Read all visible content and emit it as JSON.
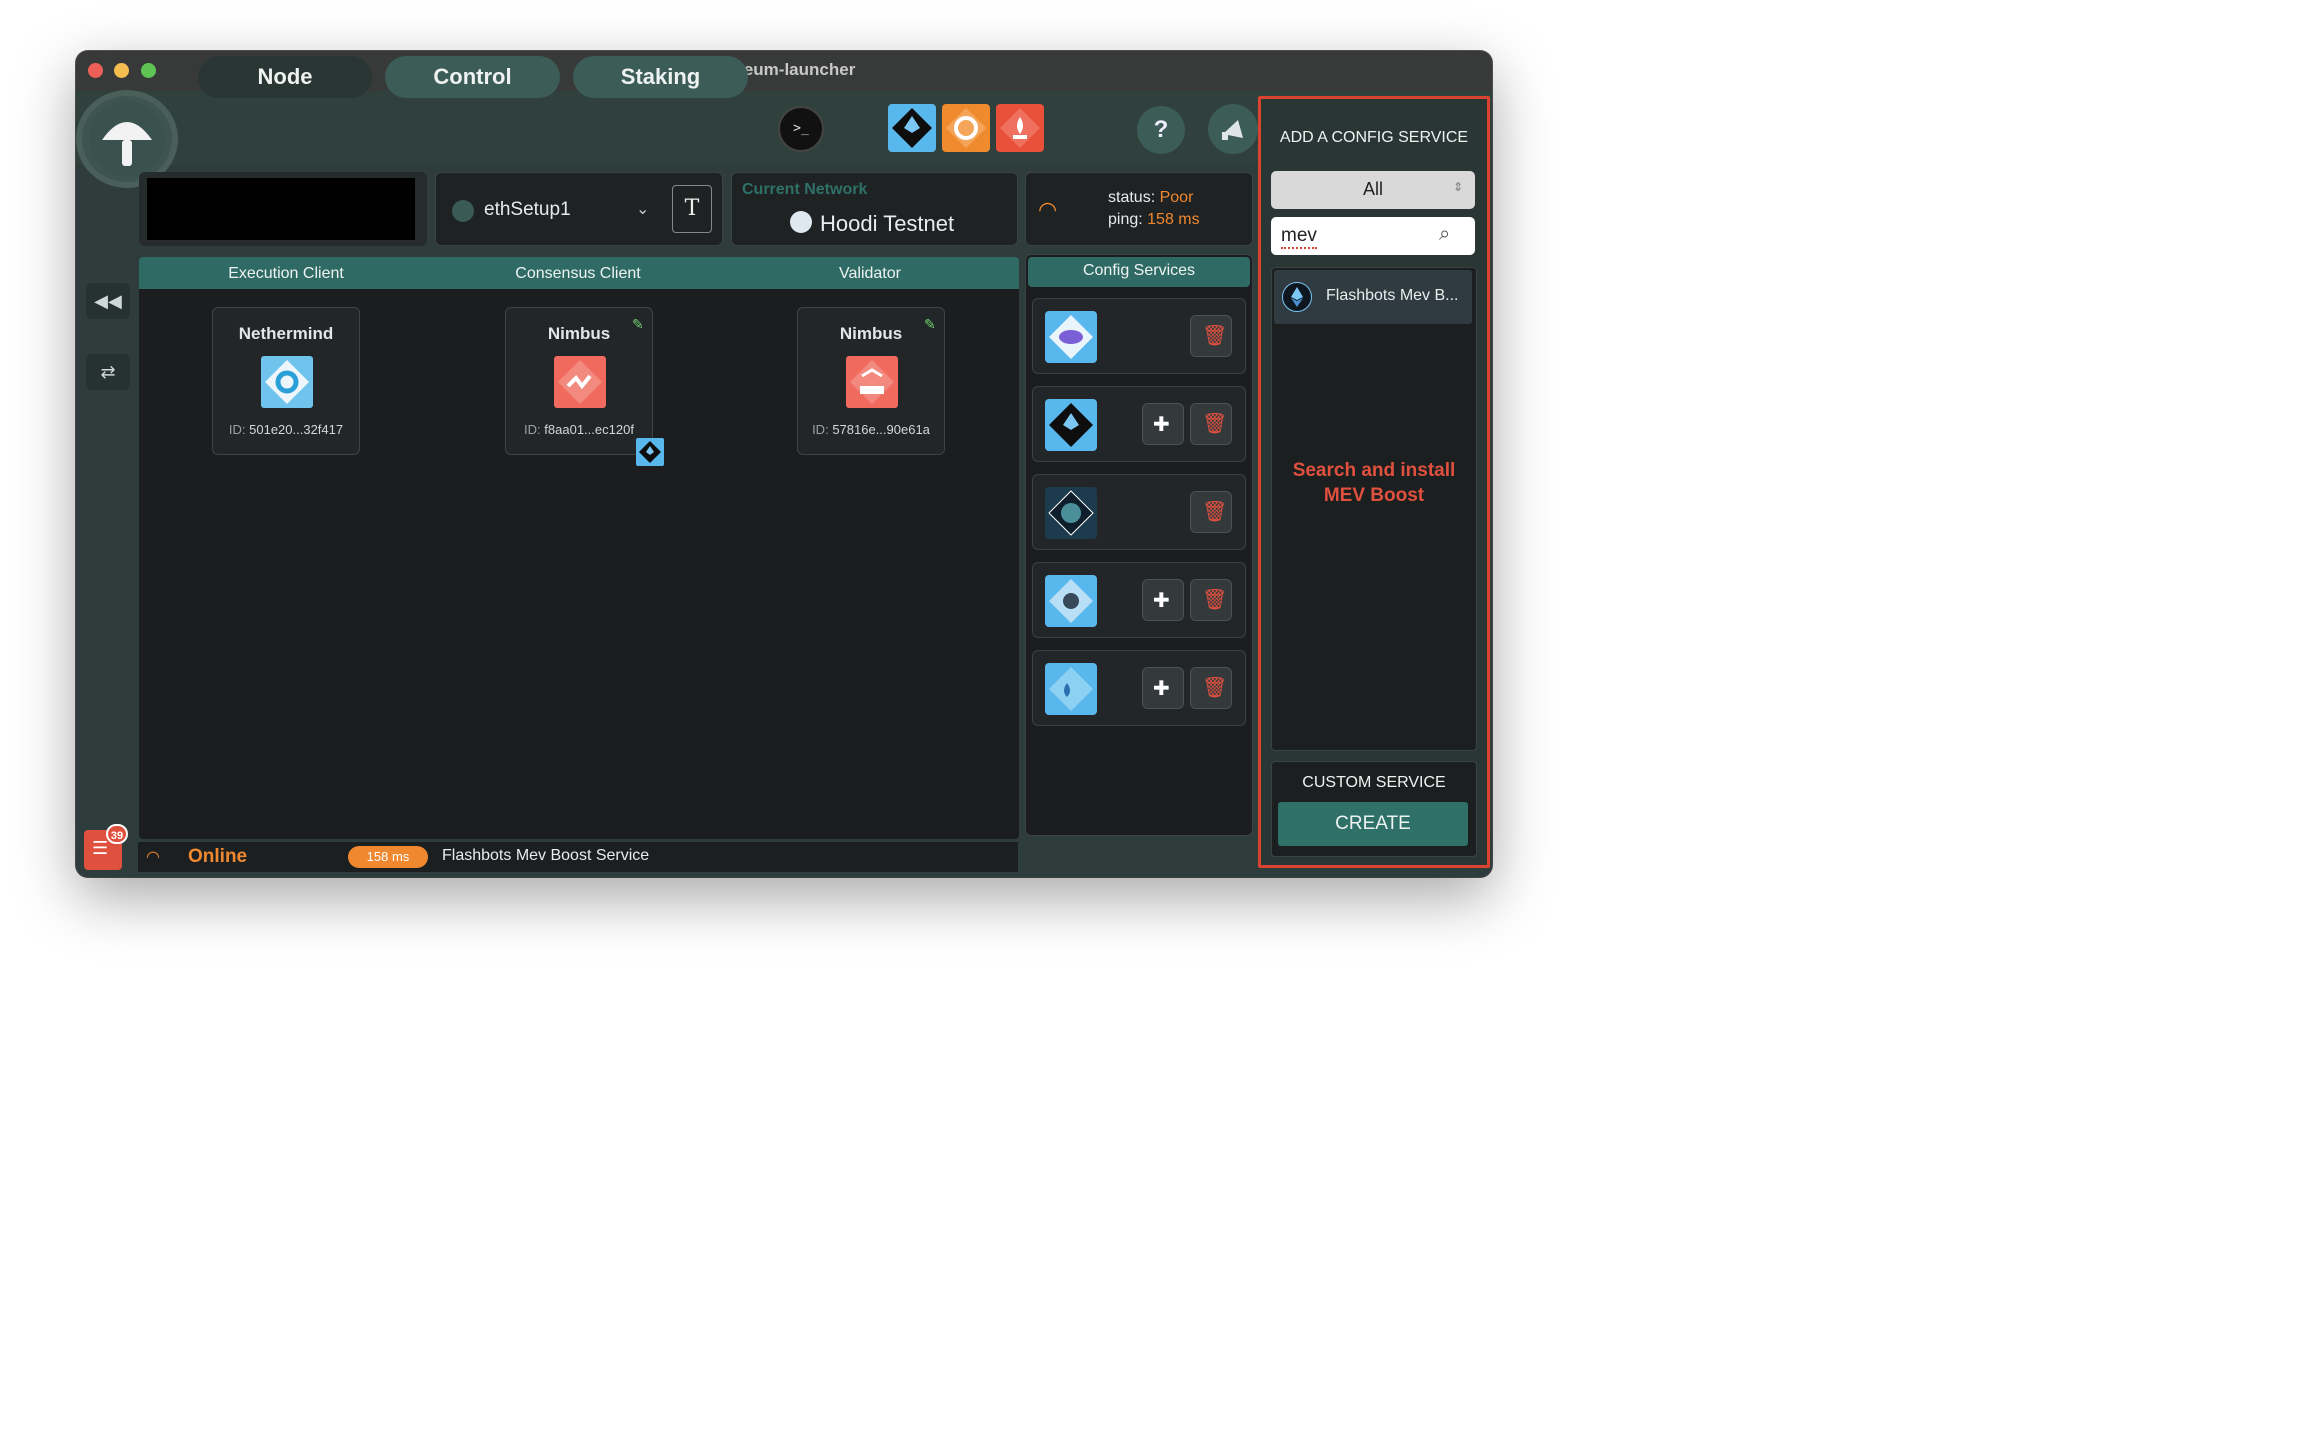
{
  "window": {
    "title": "stereum-launcher"
  },
  "nav": {
    "node": "Node",
    "control": "Control",
    "staking": "Staking",
    "help": "?"
  },
  "setup": {
    "name": "ethSetup1",
    "rename_icon_text": "T"
  },
  "network": {
    "label": "Current Network",
    "name": "Hoodi Testnet"
  },
  "connection": {
    "status_label": "status:",
    "status_value": "Poor",
    "ping_label": "ping:",
    "ping_value": "158 ms"
  },
  "columns": {
    "execution": "Execution Client",
    "consensus": "Consensus Client",
    "validator": "Validator",
    "config": "Config Services"
  },
  "clients": [
    {
      "name": "Nethermind",
      "id_label": "ID:",
      "id": "501e20...32f417"
    },
    {
      "name": "Nimbus",
      "id_label": "ID:",
      "id": "f8aa01...ec120f"
    },
    {
      "name": "Nimbus",
      "id_label": "ID:",
      "id": "57816e...90e61a"
    }
  ],
  "config_services": [
    {
      "icon": "grafana-style-icon",
      "has_connect": false
    },
    {
      "icon": "ethereum-diamond-icon",
      "has_connect": true
    },
    {
      "icon": "ipfs-icon",
      "has_connect": false
    },
    {
      "icon": "network-hexagon-icon",
      "has_connect": true
    },
    {
      "icon": "water-drop-icon",
      "has_connect": true
    }
  ],
  "status_bar": {
    "online": "Online",
    "ping": "158 ms",
    "message": "Flashbots Mev Boost Service",
    "notifications": "39"
  },
  "add_config": {
    "title": "ADD A CONFIG SERVICE",
    "filter_value": "All",
    "search_value": "mev",
    "results": [
      {
        "label": "Flashbots Mev B..."
      }
    ],
    "annotation": "Search and install MEV Boost",
    "custom_title": "CUSTOM SERVICE",
    "create_label": "CREATE"
  },
  "colors": {
    "accent_teal": "#2f7069",
    "warning_orange": "#f0882f",
    "highlight_red": "#d9432f"
  }
}
